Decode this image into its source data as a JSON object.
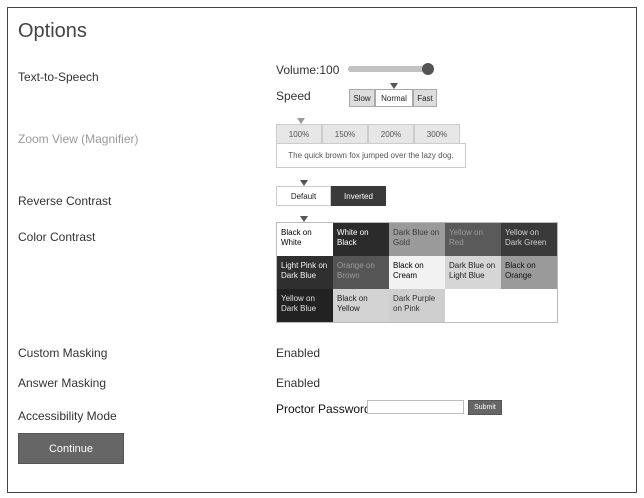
{
  "title": "Options",
  "labels": {
    "tts": "Text-to-Speech",
    "zoom": "Zoom View (Magnifier)",
    "reverse": "Reverse Contrast",
    "color": "Color Contrast",
    "custom_masking": "Custom Masking",
    "answer_masking": "Answer Masking",
    "accessibility": "Accessibility Mode"
  },
  "tts": {
    "volume_label": "Volume:100",
    "volume_value": 100,
    "speed_label": "Speed",
    "speed_options": [
      "Slow",
      "Normal",
      "Fast"
    ],
    "speed_selected": "Normal"
  },
  "zoom": {
    "options": [
      "100%",
      "150%",
      "200%",
      "300%"
    ],
    "selected": "100%",
    "preview_text": "The quick brown fox jumped over the lazy dog."
  },
  "reverse_contrast": {
    "options": [
      "Default",
      "Inverted"
    ],
    "selected": "Default"
  },
  "color_contrast": {
    "selected": "Black on White",
    "cells": [
      {
        "label": "Black on White",
        "bg": "#ffffff",
        "fg": "#000000"
      },
      {
        "label": "White on Black",
        "bg": "#2b2b2b",
        "fg": "#ffffff"
      },
      {
        "label": "Dark Blue on Gold",
        "bg": "#9a9a9a",
        "fg": "#3a3a3a"
      },
      {
        "label": "Yellow on Red",
        "bg": "#5a5a5a",
        "fg": "#9a9a9a"
      },
      {
        "label": "Yellow on Dark Green",
        "bg": "#3a3a3a",
        "fg": "#cfcfcf"
      },
      {
        "label": "Light Pink on Dark Blue",
        "bg": "#2f2f2f",
        "fg": "#f2f2f2"
      },
      {
        "label": "Orange on Brown",
        "bg": "#555555",
        "fg": "#9a9a9a"
      },
      {
        "label": "Black on Cream",
        "bg": "#f2f2f2",
        "fg": "#000000"
      },
      {
        "label": "Dark Blue on Light Blue",
        "bg": "#d6d6d6",
        "fg": "#222222"
      },
      {
        "label": "Black on Orange",
        "bg": "#9a9a9a",
        "fg": "#111111"
      },
      {
        "label": "Yellow on Dark Blue",
        "bg": "#222222",
        "fg": "#e0e0e0"
      },
      {
        "label": "Black on Yellow",
        "bg": "#d2d2d2",
        "fg": "#222222"
      },
      {
        "label": "Dark Purple on Pink",
        "bg": "#cfcfcf",
        "fg": "#333333"
      }
    ]
  },
  "custom_masking_value": "Enabled",
  "answer_masking_value": "Enabled",
  "accessibility": {
    "password_label": "Proctor Password",
    "password_value": "",
    "submit_label": "Submit"
  },
  "continue_label": "Continue"
}
